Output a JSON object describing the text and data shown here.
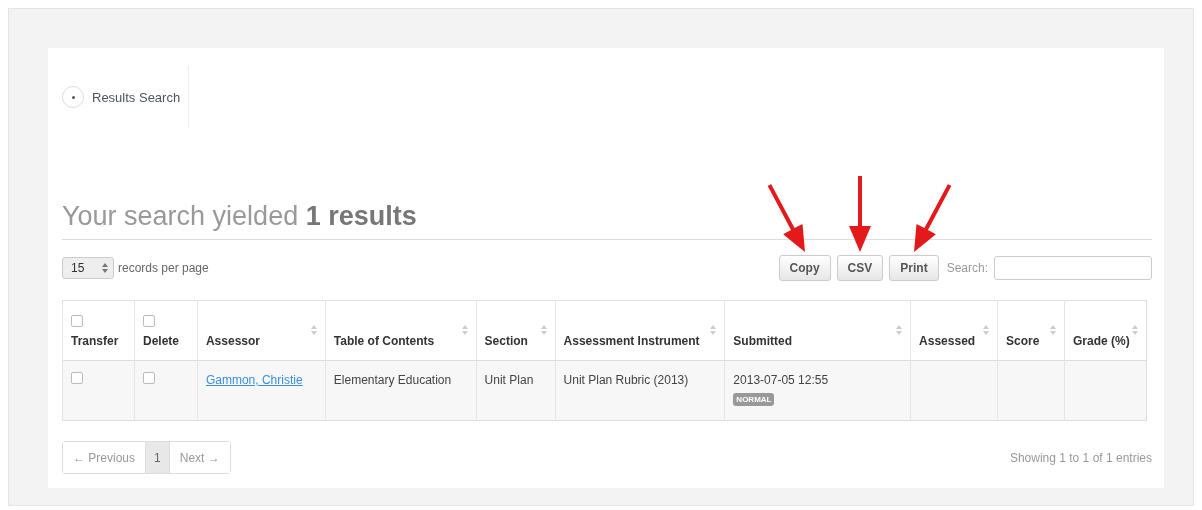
{
  "tab": {
    "label": "Results Search"
  },
  "heading": {
    "text": "Your search yielded **1 results**"
  },
  "length": {
    "value": "15",
    "label": "records per page"
  },
  "buttons": [
    {
      "label": "Copy",
      "arrow": true
    },
    {
      "label": "CSV",
      "arrow": true
    },
    {
      "label": "Print",
      "arrow": true
    }
  ],
  "search": {
    "label": "Search:"
  },
  "table": {
    "columns": [
      {
        "label": "Transfer",
        "checkbox": true,
        "checked": false,
        "sortable": false
      },
      {
        "label": "Delete",
        "checkbox": true,
        "checked": false,
        "sortable": false
      },
      {
        "label": "Assessor",
        "checkbox": false,
        "sortable": true
      },
      {
        "label": "Table of Contents",
        "checkbox": false,
        "sortable": true
      },
      {
        "label": "Section",
        "checkbox": false,
        "sortable": true
      },
      {
        "label": "Assessment Instrument",
        "checkbox": false,
        "sortable": true
      },
      {
        "label": "Submitted",
        "checkbox": false,
        "sortable": true
      },
      {
        "label": "Assessed",
        "checkbox": false,
        "sortable": true
      },
      {
        "label": "Score",
        "checkbox": false,
        "sortable": true
      },
      {
        "label": "Grade (%)",
        "checkbox": false,
        "sortable": true
      }
    ],
    "rows": [
      {
        "transfer_checked": false,
        "delete_checked": false,
        "assessor": "Gammon, Christie",
        "contents": "Elementary Education",
        "section": "Unit Plan",
        "instrument": "Unit Plan Rubric (2013)",
        "submitted": "2013-07-05 12:55",
        "badge": "NORMAL"
      }
    ]
  },
  "pagination": [
    {
      "label": "← Previous",
      "kind": "prev",
      "selected": false
    },
    {
      "label": "1",
      "kind": "page",
      "selected": true
    },
    {
      "label": "Next →",
      "kind": "next",
      "selected": false
    }
  ],
  "info": "Showing 1 to 1 of 1 entries"
}
